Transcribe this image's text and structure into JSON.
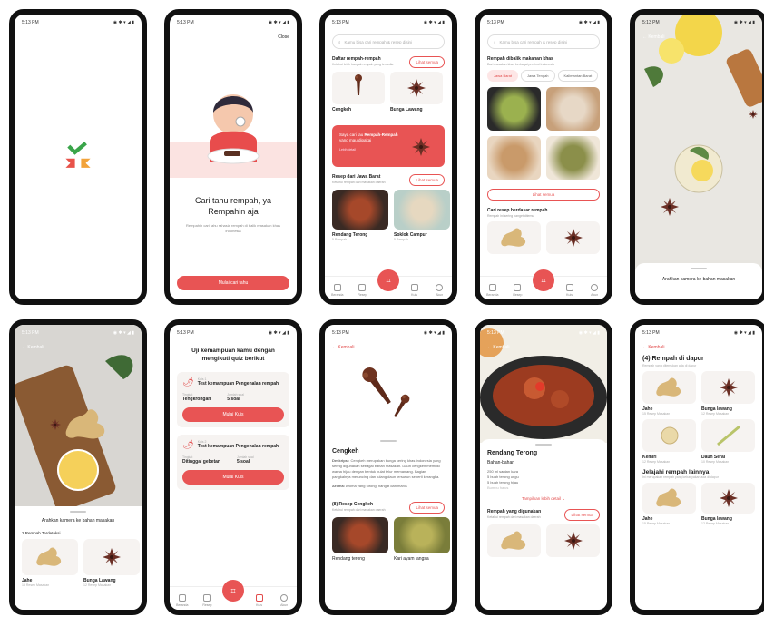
{
  "status_time": "5:13 PM",
  "onboarding": {
    "close": "Close",
    "title": "Cari tahu rempah, ya Rempahin aja",
    "desc": "Rempahin cari tahu rahasia rempah di balik masakan khas Indonesia",
    "cta": "Mulai cari tahu"
  },
  "home": {
    "search_placeholder": "Kamu bisa cari rempah & resep disini",
    "spices_title": "Daftar rempah-rempah",
    "spices_sub": "Ketahui lebih banyak rempah yang tersedia",
    "see_all": "Lihat semua",
    "spices": [
      "Cengkeh",
      "Bunga Lawang"
    ],
    "promo_a": "Saya cari tau ",
    "promo_b": "Rempah-Rempah",
    "promo_c": " yang mau dipakai",
    "promo_more": "Lebih detail",
    "recipes_title": "Resep dari Jawa Barat",
    "recipes_sub": "Ketahui rempah dari masakan daerah",
    "recipes": [
      "Rendang Terong",
      "Soklok Campur"
    ],
    "recipe_sub": "5 Rempah"
  },
  "nav": {
    "items": [
      "Beranda",
      "Resep",
      "Scan",
      "Kuis",
      "Akun"
    ]
  },
  "region": {
    "title": "Rempah dibalik makanan khas",
    "sub": "Dari masakan khas berbagai provinsi Indonesia",
    "chips": [
      "Jawa Barat",
      "Jawa Tengah",
      "Kalimantan Barat"
    ],
    "see_all": "Lihat semua",
    "title2": "Cari resep berdasar rempah",
    "sub2": "Rempah ini sering banget ditemui"
  },
  "camera": {
    "back": "Kembali",
    "hint": "Arahkan kamera ke bahan masakan"
  },
  "scan_result": {
    "back": "Kembali",
    "hint": "Arahkan kamera ke bahan masakan",
    "found": "2 Rempah Terdeteksi",
    "items": [
      {
        "name": "Jahe",
        "sub": "15 Resep Masakan"
      },
      {
        "name": "Bunga Lawang",
        "sub": "12 Resep Masakan"
      }
    ]
  },
  "quiz": {
    "title": "Uji kemampuan kamu dengan mengikuti quiz berikut",
    "cards": [
      {
        "label": "Kuis 1",
        "name": "Test kemampuan Pengenalan rempah",
        "lvl_k": "Tingkat",
        "lvl": "Tengkrongan",
        "q_k": "Jumlah soal",
        "q": "5 soal",
        "cta": "Mulai Kuis"
      },
      {
        "label": "Kuis 2",
        "name": "Test kemampuan Pengenalan rempah",
        "lvl_k": "Tingkat",
        "lvl": "Ditinggal gebetan",
        "q_k": "Jumlah soal",
        "q": "5 soal",
        "cta": "Mulai Kuis"
      }
    ]
  },
  "clove": {
    "back": "Kembali",
    "name": "Cengkeh",
    "desc_k": "Deskripsi:",
    "desc": " Cengkeh merupakan bunga kering khas Indonesia yang sering digunakan sebagai bahan masakan. Daun cengkeh memiliki warna hijau dengan bentuk bulat telur memanjang. Bagian pangkalnya meruncing dan tulang daun tersusun seperti kerangka.",
    "aroma_k": "Aroma:",
    "aroma": " Aroma yang strong, hangat dan manis",
    "recipes_title": "(8) Resep Cengkeh",
    "recipes_sub": "Ketahui rempah dari masakan daerah",
    "see_all": "Lihat semua",
    "recipes": [
      "Rendang terong",
      "Kari ayam langsa"
    ]
  },
  "recipe": {
    "back": "Kembali",
    "name": "Rendang Terong",
    "ing_title": "Bahan-bahan",
    "ings": [
      "250 ml santan kara",
      "5 buah terong ungu",
      "5 buah terong hijau",
      "Bumbu halus"
    ],
    "more": "Tampilkan lebih detail",
    "spices_title": "Rempah yang digunakan",
    "spices_sub": "Ketahui rempah dari masakan daerah",
    "see_all": "Lihat semua"
  },
  "kitchen": {
    "back": "Kembali",
    "title": "(4) Rempah di dapur",
    "sub": "Rempah yang ditemukan ada di dapur",
    "items": [
      {
        "name": "Jahe",
        "sub": "15 Resep Masakan"
      },
      {
        "name": "Bunga lawang",
        "sub": "12 Resep Masakan"
      },
      {
        "name": "Kemiri",
        "sub": "12 Resep Masakan"
      },
      {
        "name": "Daun Serai",
        "sub": "10 Resep Masakan"
      }
    ],
    "explore": "Jelajahi rempah lainnya",
    "explore_sub": "Ini merupakan rempah yang kebanyakan ada di dapur",
    "items2": [
      {
        "name": "Jahe",
        "sub": "15 Resep Masakan"
      },
      {
        "name": "Bunga lawang",
        "sub": "12 Resep Masakan"
      }
    ]
  }
}
